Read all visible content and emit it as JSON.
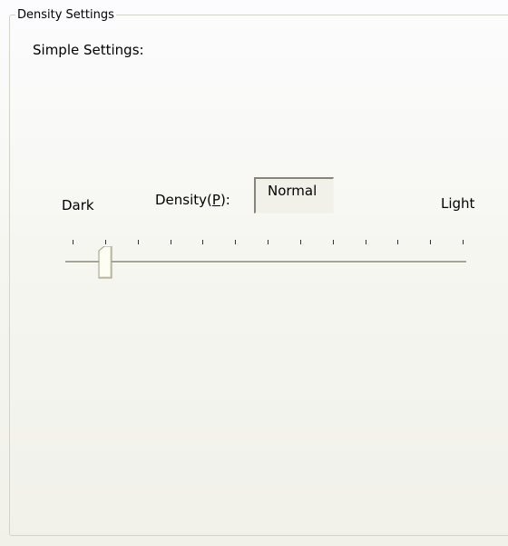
{
  "group": {
    "title": "Density Settings"
  },
  "simple_settings_label": "Simple Settings:",
  "slider": {
    "min_label": "Dark",
    "max_label": "Light",
    "label_prefix": "Density(",
    "label_mnemonic": "P",
    "label_suffix": "):",
    "current_value_text": "Normal",
    "position_index": 1,
    "tick_count": 13
  }
}
